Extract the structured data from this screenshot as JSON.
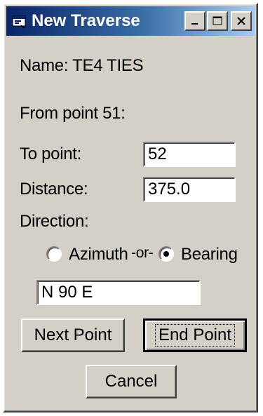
{
  "window": {
    "title": "New Traverse"
  },
  "titlebar": {
    "minimize_glyph": "_",
    "maximize_glyph": "□",
    "close_glyph": "✕"
  },
  "info": {
    "name_label": "Name: TE4 TIES",
    "from_label": "From point 51:"
  },
  "fields": {
    "to_point_label": "To point:",
    "to_point_value": "52",
    "distance_label": "Distance:",
    "distance_value": "375.0",
    "direction_label": "Direction:"
  },
  "direction": {
    "azimuth_label": "Azimuth",
    "or_label": "-or-",
    "bearing_label": "Bearing",
    "selected": "Bearing",
    "value": "N 90 E"
  },
  "buttons": {
    "next_point": "Next Point",
    "end_point": "End Point",
    "cancel": "Cancel"
  }
}
